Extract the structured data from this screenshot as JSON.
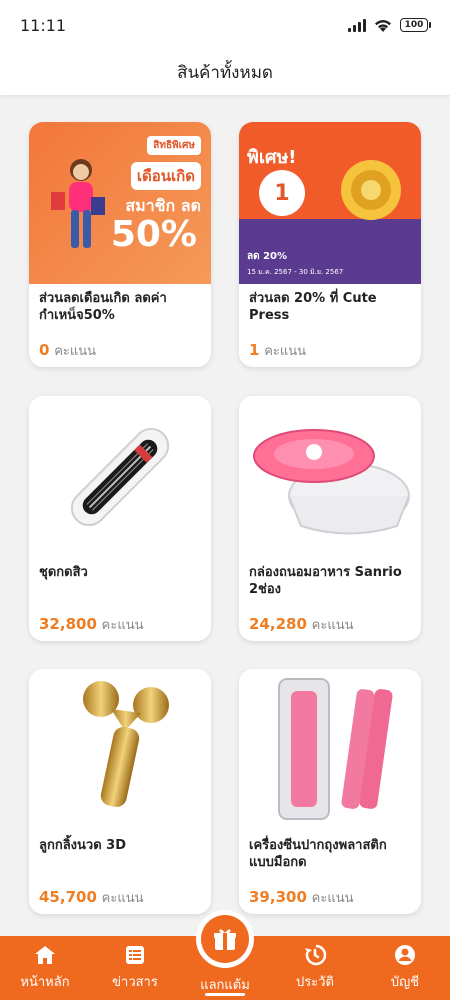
{
  "status_bar": {
    "time": "11:11",
    "battery": "100"
  },
  "header": {
    "title": "สินค้าทั้งหมด"
  },
  "products": [
    {
      "title": "ส่วนลดเดือนเกิด ลดค่ากำเหน็จ50%",
      "points": "0",
      "unit": "คะแนน",
      "banner_text": [
        "สิทธิพิเศษ",
        "เดือนเกิด",
        "สมาชิก",
        "ลด",
        "50%"
      ]
    },
    {
      "title": "ส่วนลด 20% ที่ Cute Press",
      "points": "1",
      "unit": "คะแนน",
      "banner_text": [
        "พิเศษ!",
        "1",
        "ลด 20%",
        "15 ม.ค. 2567 - 30 มิ.ย. 2567"
      ]
    },
    {
      "title": "ชุดกดสิว",
      "points": "32,800",
      "unit": "คะแนน"
    },
    {
      "title": "กล่องถนอมอาหาร Sanrio 2ช่อง",
      "points": "24,280",
      "unit": "คะแนน"
    },
    {
      "title": "ลูกกลิ้งนวด 3D",
      "points": "45,700",
      "unit": "คะแนน"
    },
    {
      "title": "เครื่องซีนปากถุงพลาสติก แบบมือกด",
      "points": "39,300",
      "unit": "คะแนน"
    }
  ],
  "bottom_nav": {
    "items": [
      {
        "label": "หน้าหลัก",
        "icon": "home-icon"
      },
      {
        "label": "ข่าวสาร",
        "icon": "news-icon"
      },
      {
        "label": "แลกแต้ม",
        "icon": "gift-icon"
      },
      {
        "label": "ประวัติ",
        "icon": "history-icon"
      },
      {
        "label": "บัญชี",
        "icon": "account-icon"
      }
    ]
  },
  "colors": {
    "accent": "#ef6a1f",
    "points": "#ef7d22"
  }
}
